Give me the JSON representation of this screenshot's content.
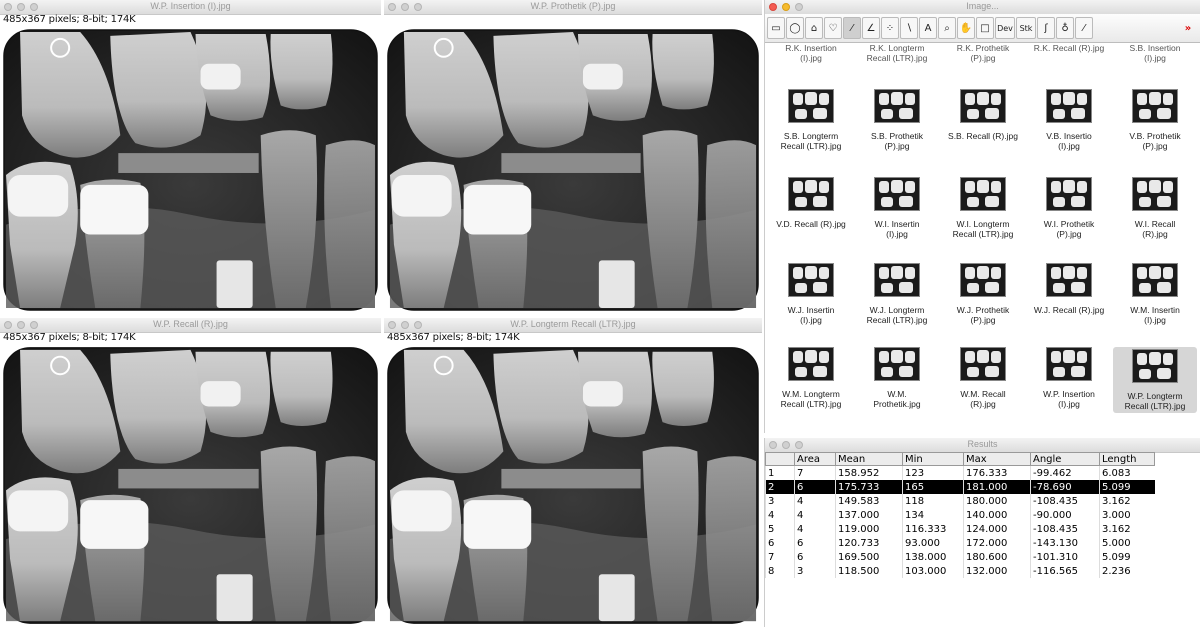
{
  "xray_windows": [
    {
      "title": "W.P. Insertion (I).jpg",
      "info": "485x367 pixels; 8-bit; 174K"
    },
    {
      "title": "W.P. Prothetik (P).jpg",
      "info": "485x367 pixels; 8-bit; 174K"
    },
    {
      "title": "W.P. Recall (R).jpg",
      "info": "485x367 pixels; 8-bit; 174K"
    },
    {
      "title": "W.P. Longterm Recall (LTR).jpg",
      "info": "485x367 pixels; 8-bit; 174K"
    }
  ],
  "image_window": {
    "title": "Image...",
    "tools": [
      {
        "icon": "rectangle-select-icon",
        "glyph": "▭"
      },
      {
        "icon": "oval-select-icon",
        "glyph": "◯"
      },
      {
        "icon": "polygon-select-icon",
        "glyph": "⌂"
      },
      {
        "icon": "freehand-select-icon",
        "glyph": "♡"
      },
      {
        "icon": "line-tool-icon",
        "glyph": "⁄"
      },
      {
        "icon": "angle-tool-icon",
        "glyph": "∠"
      },
      {
        "icon": "point-tool-icon",
        "glyph": "⁘"
      },
      {
        "icon": "wand-tool-icon",
        "glyph": "∖"
      },
      {
        "icon": "text-tool-icon",
        "glyph": "A"
      },
      {
        "icon": "magnifier-icon",
        "glyph": "⌕"
      },
      {
        "icon": "hand-tool-icon",
        "glyph": "✋"
      },
      {
        "icon": "color-picker-icon",
        "glyph": "□"
      },
      {
        "icon": "dev-tool",
        "glyph": "Dev"
      },
      {
        "icon": "stk-tool",
        "glyph": "Stk"
      },
      {
        "icon": "lut-tool-icon",
        "glyph": "ʃ"
      },
      {
        "icon": "drop-tool-icon",
        "glyph": "♁"
      },
      {
        "icon": "pipette-tool-icon",
        "glyph": "⁄"
      },
      {
        "icon": "more-tools-icon",
        "glyph": "»"
      }
    ],
    "top_row": [
      "R.K. Insertion\n(I).jpg",
      "R.K. Longterm\nRecall (LTR).jpg",
      "R.K. Prothetik\n(P).jpg",
      "R.K. Recall (R).jpg",
      "S.B. Insertion\n(I).jpg"
    ],
    "thumbnails": [
      "S.B. Longterm\nRecall (LTR).jpg",
      "S.B. Prothetik\n(P).jpg",
      "S.B. Recall (R).jpg",
      "V.B. Insertio\n(I).jpg",
      "V.B. Prothetik\n(P).jpg",
      "V.D. Recall (R).jpg",
      "W.I. Insertin\n(I).jpg",
      "W.I. Longterm\nRecall (LTR).jpg",
      "W.I. Prothetik\n(P).jpg",
      "W.I. Recall\n(R).jpg",
      "W.J. Insertin\n(I).jpg",
      "W.J. Longterm\nRecall (LTR).jpg",
      "W.J. Prothetik\n(P).jpg",
      "W.J. Recall (R).jpg",
      "W.M. Insertin\n(I).jpg",
      "W.M. Longterm\nRecall (LTR).jpg",
      "W.M.\nProthetik.jpg",
      "W.M. Recall\n(R).jpg",
      "W.P. Insertion\n(I).jpg",
      "W.P. Longterm\nRecall (LTR).jpg"
    ],
    "selected_index": 19
  },
  "results": {
    "title": "Results",
    "columns": [
      "",
      "Area",
      "Mean",
      "Min",
      "Max",
      "Angle",
      "Length"
    ],
    "rows": [
      [
        "1",
        "7",
        "158.952",
        "123",
        "176.333",
        "-99.462",
        "6.083"
      ],
      [
        "2",
        "6",
        "175.733",
        "165",
        "181.000",
        "-78.690",
        "5.099"
      ],
      [
        "3",
        "4",
        "149.583",
        "118",
        "180.000",
        "-108.435",
        "3.162"
      ],
      [
        "4",
        "4",
        "137.000",
        "134",
        "140.000",
        "-90.000",
        "3.000"
      ],
      [
        "5",
        "4",
        "119.000",
        "116.333",
        "124.000",
        "-108.435",
        "3.162"
      ],
      [
        "6",
        "6",
        "120.733",
        "93.000",
        "172.000",
        "-143.130",
        "5.000"
      ],
      [
        "7",
        "6",
        "169.500",
        "138.000",
        "180.600",
        "-101.310",
        "5.099"
      ],
      [
        "8",
        "3",
        "118.500",
        "103.000",
        "132.000",
        "-116.565",
        "2.236"
      ]
    ],
    "selected_row": 1
  }
}
